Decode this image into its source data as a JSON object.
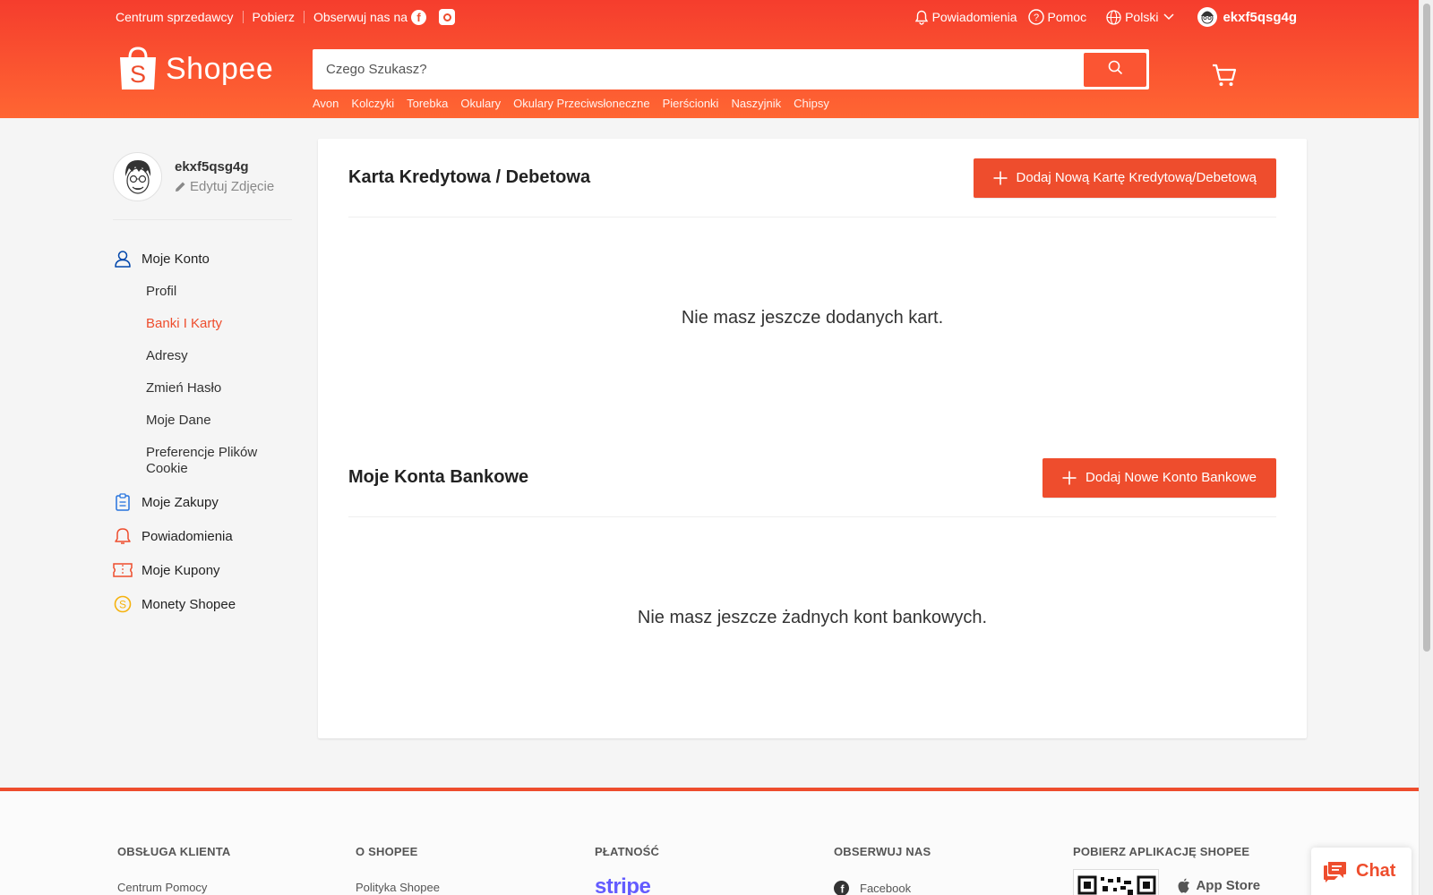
{
  "topbar": {
    "seller_center": "Centrum sprzedawcy",
    "download": "Pobierz",
    "follow_us": "Obserwuj nas na",
    "notifications": "Powiadomienia",
    "help": "Pomoc",
    "language": "Polski",
    "username": "ekxf5qsg4g"
  },
  "logo": {
    "text": "Shopee"
  },
  "search": {
    "placeholder": "Czego Szukasz?",
    "suggestions": [
      "Avon",
      "Kolczyki",
      "Torebka",
      "Okulary",
      "Okulary Przeciwsłoneczne",
      "Pierścionki",
      "Naszyjnik",
      "Chipsy"
    ]
  },
  "sidebar": {
    "username": "ekxf5qsg4g",
    "edit_photo": "Edytuj Zdjęcie",
    "my_account": "Moje Konto",
    "account_items": [
      "Profil",
      "Banki I Karty",
      "Adresy",
      "Zmień Hasło",
      "Moje Dane",
      "Preferencje Plików Cookie"
    ],
    "active_item": "Banki I Karty",
    "my_purchases": "Moje Zakupy",
    "notifications": "Powiadomienia",
    "my_vouchers": "Moje Kupony",
    "coins": "Monety Shopee"
  },
  "cards": {
    "title": "Karta Kredytowa / Debetowa",
    "add_button": "Dodaj Nową Kartę Kredytową/Debetową",
    "empty": "Nie masz jeszcze dodanych kart."
  },
  "banks": {
    "title": "Moje Konta Bankowe",
    "add_button": "Dodaj Nowe Konto Bankowe",
    "empty": "Nie masz jeszcze żadnych kont bankowych."
  },
  "footer": {
    "customer_service": "OBSŁUGA KLIENTA",
    "help_center": "Centrum Pomocy",
    "about": "O SHOPEE",
    "policy": "Polityka Shopee",
    "payment": "PŁATNOŚĆ",
    "stripe": "stripe",
    "follow": "OBSERWUJ NAS",
    "facebook": "Facebook",
    "download_app": "POBIERZ APLIKACJĘ SHOPEE",
    "app_store": "App Store"
  },
  "chat": {
    "label": "Chat"
  },
  "colors": {
    "brand": "#ee4d2d",
    "header_top": "#f53d2d",
    "header_bottom": "#ff6633"
  },
  "icons": [
    "bell-icon",
    "help-icon",
    "globe-icon",
    "search-icon",
    "cart-icon",
    "user-icon",
    "clipboard-icon",
    "bell-icon",
    "voucher-icon",
    "coin-icon",
    "plus-icon",
    "chat-icon"
  ]
}
